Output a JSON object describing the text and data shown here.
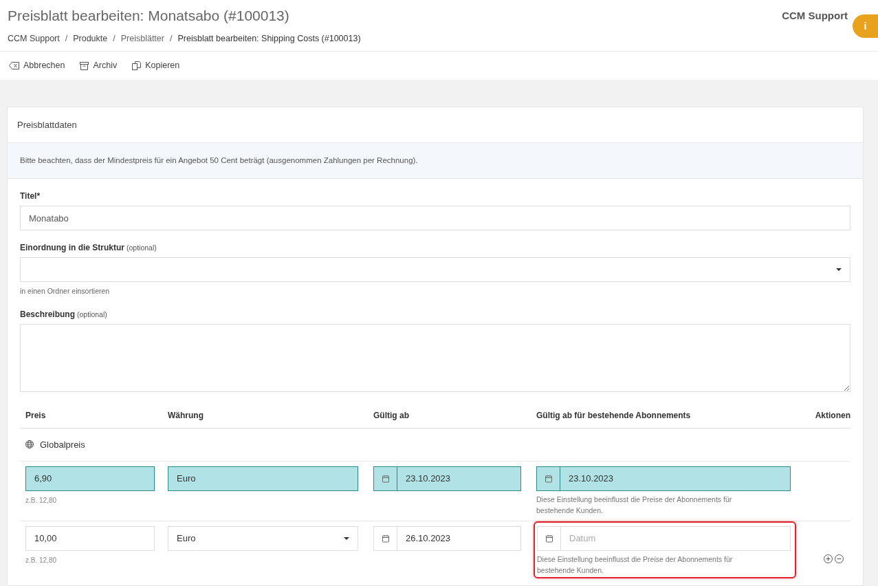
{
  "page_title": "Preisblatt bearbeiten: Monatsabo (#100013)",
  "breadcrumbs": [
    {
      "label": "CCM Support",
      "current": false
    },
    {
      "label": "Produkte",
      "current": false
    },
    {
      "label": "Preisblätter",
      "current": false
    },
    {
      "label": "Preisblatt bearbeiten: Shipping Costs (#100013)",
      "current": true
    }
  ],
  "breadcrumb_separator": "/",
  "user": "CCM Support",
  "info_badge": "i",
  "toolbar": [
    {
      "kind": "cancel",
      "label": "Abbrechen"
    },
    {
      "kind": "archive",
      "label": "Archiv"
    },
    {
      "kind": "copy",
      "label": "Kopieren"
    }
  ],
  "card": {
    "title": "Preisblattdaten",
    "notice": "Bitte beachten, dass der Mindestpreis für ein Angebot 50 Cent beträgt (ausgenommen Zahlungen per Rechnung).",
    "fields": [
      {
        "kind": "text",
        "label": "Titel",
        "required_mark": "*",
        "value": "Monatabo"
      },
      {
        "kind": "select",
        "label": "Einordnung in die Struktur",
        "optional": "(optional)",
        "hint": "in einen Ordner einsortieren"
      },
      {
        "kind": "textarea",
        "label": "Beschreibung",
        "optional": "(optional)"
      }
    ],
    "table": {
      "columns": [
        "Preis",
        "Währung",
        "Gültig ab",
        "Gültig ab für bestehende Abonnements",
        "Aktionen"
      ],
      "group_label": "Globalpreis",
      "rows": [
        {
          "highlighted": true,
          "price": "6,90",
          "price_hint": "z.B. 12,80",
          "currency": "Euro",
          "currency_dropdown": false,
          "valid_from": "23.10.2023",
          "existing_from": "23.10.2023",
          "existing_error": false,
          "existing_hint": "Diese Einstellung beeinflusst die Preise der Abonnements für bestehende Kunden.",
          "actions": false
        },
        {
          "highlighted": false,
          "price": "10,00",
          "price_hint": "z.B. 12,80",
          "currency": "Euro",
          "currency_dropdown": true,
          "valid_from": "26.10.2023",
          "existing_placeholder": "Datum",
          "existing_error": true,
          "existing_hint": "Diese Einstellung beeinflusst die Preise der Abonnements für bestehende Kunden.",
          "actions": true
        }
      ]
    }
  }
}
